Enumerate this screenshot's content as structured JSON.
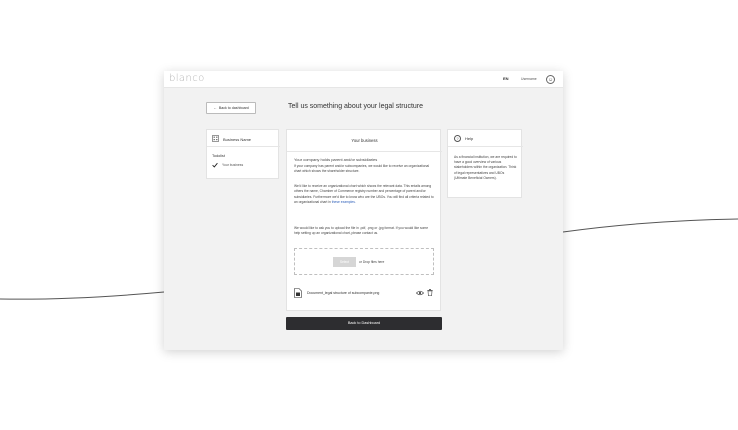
{
  "header": {
    "logo": "blanco",
    "language": "EN",
    "username": "Username",
    "user_icon": "user-circle-icon"
  },
  "nav": {
    "back_label": "Back to dashboard"
  },
  "page": {
    "title": "Tell us something about your legal structure"
  },
  "sidebar": {
    "business_name": "Business Name",
    "todolist_label": "Todolist",
    "todo_items": [
      "Your business"
    ]
  },
  "main": {
    "header": "Your business",
    "question": "Your company holds parent and/or subsidiaries",
    "para1": "If your company has parent and/or subcompanies, we would like to receive an organizational chart which shows the shareholder structure.",
    "para2_text": "We'd like to receive an organizational chart which shows the relevant data. This entails among others the name, Chamber of Commerce registry number and percentage of parent and/or subsidiaries. Furthermore we'd like to know who are the UBOs. You will find all criteria related to an organizational chart in",
    "para2_link": "these examples.",
    "para3": "We would like to ask you to upload the file in .pdf, .png or .jpg format. If you would like some help setting up an organizational chart, please contact us.",
    "select_label": "Select",
    "drop_label": "or Drop files here",
    "file_name": "Document_legal structure of subcompanie.png",
    "bottom_button": "Back to Dashboard"
  },
  "help": {
    "title": "Help",
    "text": "As a financial institution, we are required to have a good overview of various stakeholders within the organization. Think of legal representatives and UBOs (Ultimate Beneficial Owners)."
  },
  "colors": {
    "primary_button": "#2d2d30",
    "link": "#2a5cb8",
    "background": "#f2f2f2"
  }
}
